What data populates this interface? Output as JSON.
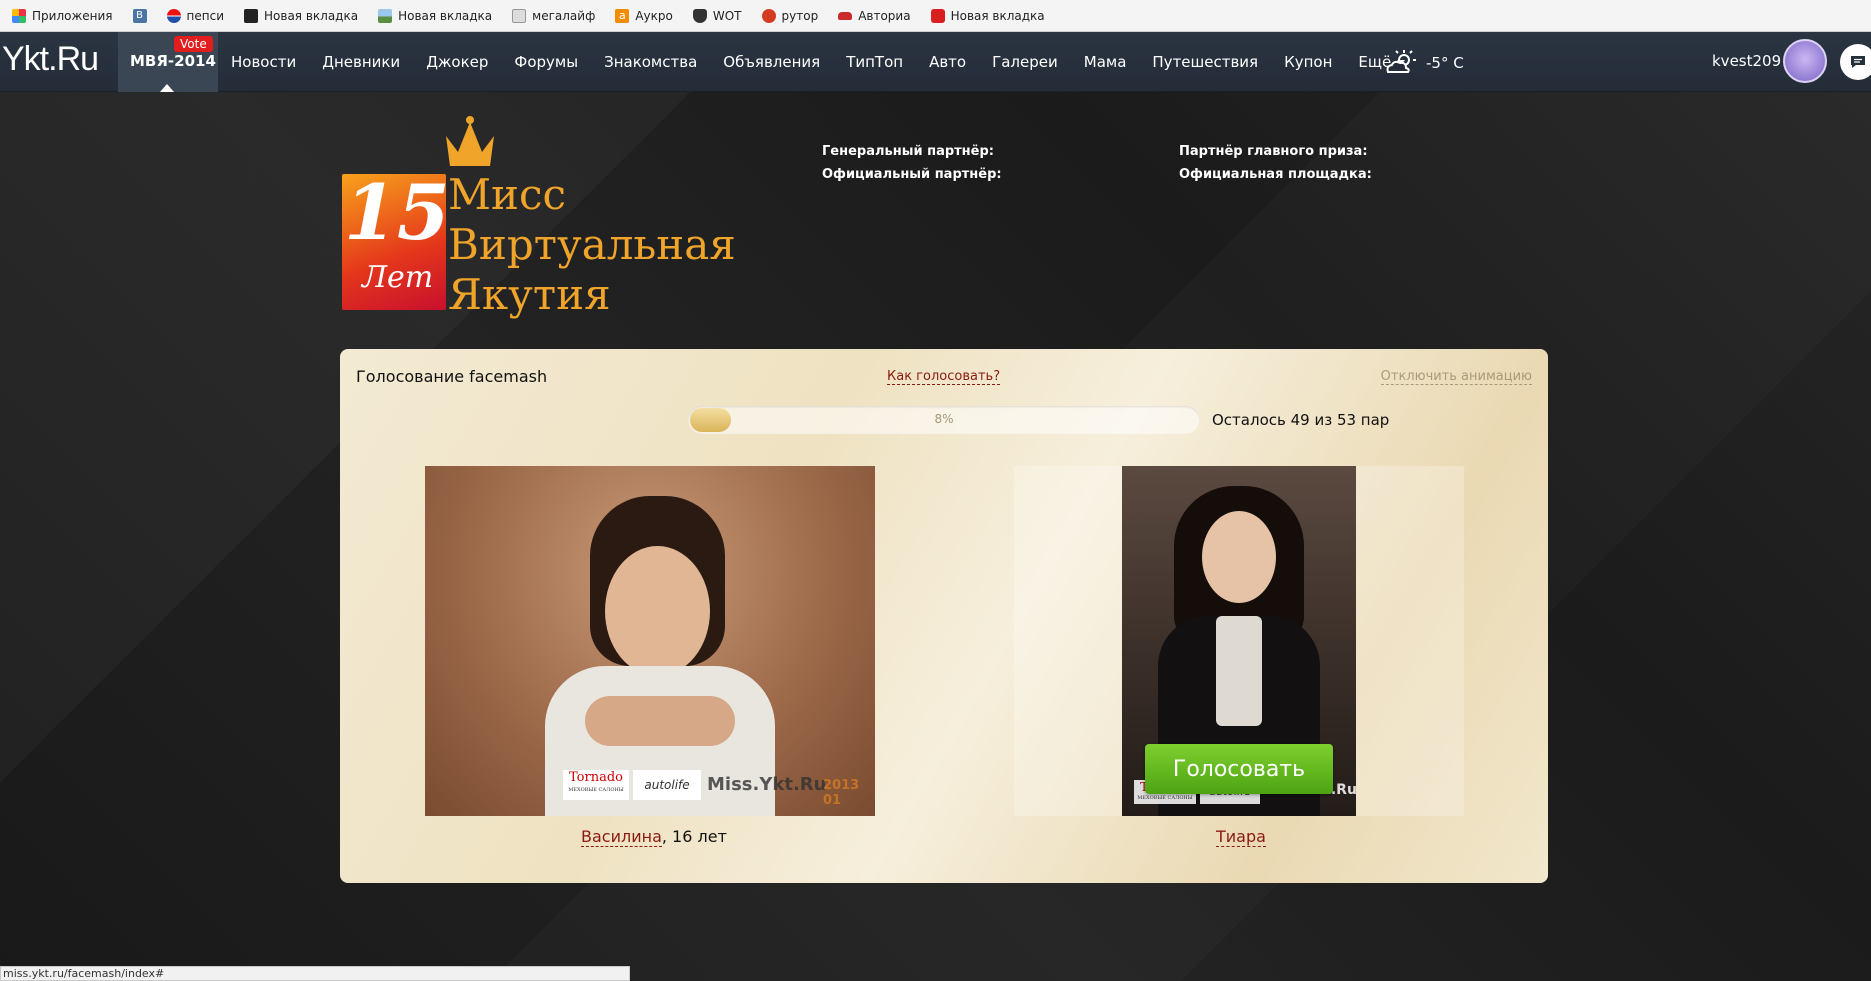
{
  "bookmarks": [
    {
      "label": "Приложения",
      "icon": "apps-grid-icon",
      "color": "#4a7fd6"
    },
    {
      "label": "",
      "icon": "vk-icon",
      "color": "#4c75a3"
    },
    {
      "label": "пепси",
      "icon": "pepsi-icon",
      "color": "#1f4fa8"
    },
    {
      "label": "Новая вкладка",
      "icon": "film-icon",
      "color": "#222222"
    },
    {
      "label": "Новая вкладка",
      "icon": "landscape-icon",
      "color": "#5a8fc7"
    },
    {
      "label": "мегалайф",
      "icon": "megalife-icon",
      "color": "#6d6d6d"
    },
    {
      "label": "Аукро",
      "icon": "aukro-icon",
      "color": "#f28c00"
    },
    {
      "label": "WOT",
      "icon": "wot-shield-icon",
      "color": "#333333"
    },
    {
      "label": "рутор",
      "icon": "rutor-icon",
      "color": "#d43b1f"
    },
    {
      "label": "Авториа",
      "icon": "car-icon",
      "color": "#cc2a2a"
    },
    {
      "label": "Новая вкладка",
      "icon": "youtube-icon",
      "color": "#d81e1e"
    }
  ],
  "nav": {
    "logo": "Ykt.Ru",
    "active": {
      "label": "МВЯ-2014",
      "badge": "Vote"
    },
    "items": [
      "Новости",
      "Дневники",
      "Джокер",
      "Форумы",
      "Знакомства",
      "Объявления",
      "ТипТоп",
      "Авто",
      "Галереи",
      "Мама",
      "Путешествия",
      "Купон",
      "Ещё"
    ],
    "weather": "-5° C",
    "username": "kvest209"
  },
  "header": {
    "logo_number": "15",
    "logo_years": "Лет",
    "title_lines": [
      "Мисс",
      "Виртуальная",
      "Якутия"
    ],
    "partners_left": [
      "Генеральный партнёр:",
      "Официальный партнёр:"
    ],
    "partners_right": [
      "Партнёр главного приза:",
      "Официальная площадка:"
    ]
  },
  "voting": {
    "title": "Голосование facemash",
    "how_link": "Как голосовать?",
    "disable_anim": "Отключить анимацию",
    "progress_percent": 8,
    "progress_label": "8%",
    "remaining": "Осталось 49 из 53 пар",
    "vote_button": "Голосовать",
    "left": {
      "name": "Василина",
      "suffix": ", 16 лет",
      "watermark": "Miss.Ykt.Ru",
      "sponsor1": "Tornado",
      "sponsor1_sub": "МЕХОВЫЕ САЛОНЫ",
      "sponsor2": "autolife",
      "date_mark": "2013 01"
    },
    "right": {
      "name": "Тиара",
      "suffix": "",
      "watermark": "Miss.Ykt.Ru",
      "sponsor1": "Tornado",
      "sponsor1_sub": "МЕХОВЫЕ САЛОНЫ",
      "sponsor2": "autolife"
    }
  },
  "status_url": "miss.ykt.ru/facemash/index#",
  "colors": {
    "accent_orange": "#f0a52a",
    "link_red": "#8a1a10",
    "vote_green": "#5cb81c",
    "nav_bg": "#26303b",
    "badge_red": "#e21d1d"
  }
}
